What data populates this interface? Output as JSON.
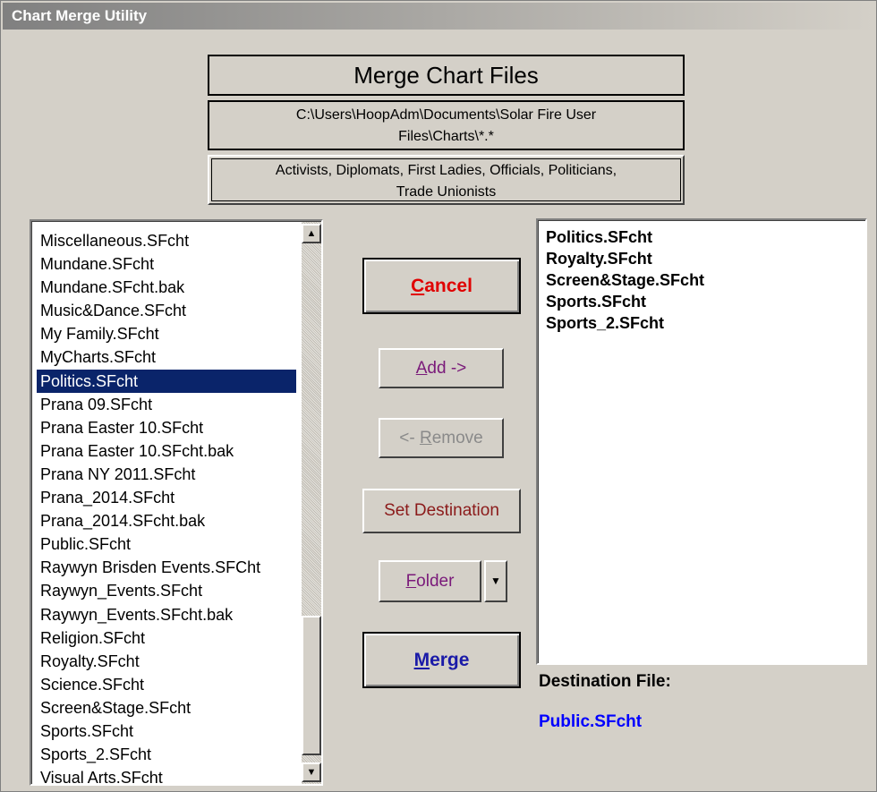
{
  "window": {
    "title": "Chart Merge Utility"
  },
  "header": {
    "heading": "Merge Chart Files",
    "path": [
      "C:\\Users\\HoopAdm\\Documents\\Solar Fire User",
      "Files\\Charts\\*.*"
    ],
    "categories": [
      "Activists, Diplomats, First Ladies, Officials, Politicians,",
      "Trade Unionists"
    ]
  },
  "source_list": {
    "items": [
      "Miscellaneous.SFcht",
      "Mundane.SFcht",
      "Mundane.SFcht.bak",
      "Music&Dance.SFcht",
      "My Family.SFcht",
      "MyCharts.SFcht",
      "Politics.SFcht",
      "Prana 09.SFcht",
      "Prana Easter 10.SFcht",
      "Prana Easter 10.SFcht.bak",
      "Prana NY 2011.SFcht",
      "Prana_2014.SFcht",
      "Prana_2014.SFcht.bak",
      "Public.SFcht",
      "Raywyn Brisden Events.SFCht",
      "Raywyn_Events.SFcht",
      "Raywyn_Events.SFcht.bak",
      "Religion.SFcht",
      "Royalty.SFcht",
      "Science.SFcht",
      "Screen&Stage.SFcht",
      "Sports.SFcht",
      "Sports_2.SFcht",
      "Visual Arts.SFcht"
    ],
    "selected": "Politics.SFcht"
  },
  "buttons": {
    "cancel": {
      "underline": "C",
      "rest": "ancel"
    },
    "add": {
      "underline": "A",
      "rest": "dd ->"
    },
    "remove": {
      "prefix": "<- ",
      "underline": "R",
      "rest": "emove"
    },
    "set_destination": "Set Destination",
    "folder": {
      "underline": "F",
      "rest": "older"
    },
    "merge": {
      "underline": "M",
      "rest": "erge"
    }
  },
  "dest_list": {
    "items": [
      "Politics.SFcht",
      "Royalty.SFcht",
      "Screen&Stage.SFcht",
      "Sports.SFcht",
      "Sports_2.SFcht"
    ]
  },
  "destination": {
    "label": "Destination File:",
    "file": "Public.SFcht"
  },
  "icons": {
    "scroll_up": "arrow-up-icon",
    "scroll_down": "arrow-down-icon",
    "dropdown": "dropdown-arrow-icon"
  },
  "colors": {
    "selection": "#0a246a",
    "cancel": "#e00000",
    "merge": "#1a1aa8",
    "destination_file": "#0000ff"
  }
}
